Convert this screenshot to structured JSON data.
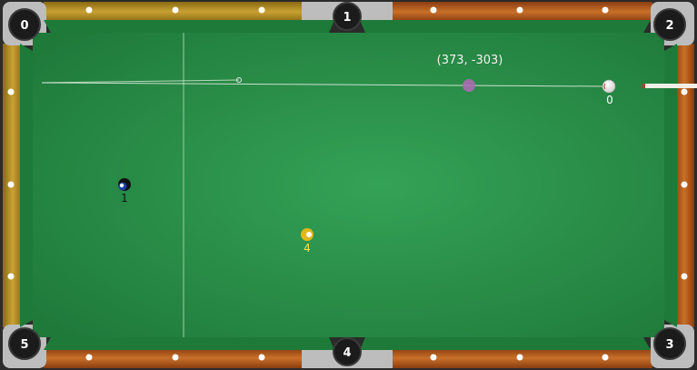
{
  "pockets": [
    {
      "id": "pocket-0",
      "label": "0"
    },
    {
      "id": "pocket-1",
      "label": "1"
    },
    {
      "id": "pocket-2",
      "label": "2"
    },
    {
      "id": "pocket-3",
      "label": "3"
    },
    {
      "id": "pocket-4",
      "label": "4"
    },
    {
      "id": "pocket-5",
      "label": "5"
    }
  ],
  "balls": [
    {
      "id": "cue",
      "label": "0",
      "color": "#ffffff",
      "label_color": "#ffffff"
    },
    {
      "id": "ball-1",
      "label": "1",
      "color": "#1a3fa0",
      "label_color": "#111111"
    },
    {
      "id": "ball-4",
      "label": "4",
      "color": "#e0b818",
      "label_color": "#ffe14a"
    }
  ],
  "aim": {
    "coordinate_text": "(373, -303)",
    "target_color": "#b06ab8"
  },
  "colors": {
    "felt": "#2f9a4f",
    "rail_wood": "#b8621f",
    "rail_gold": "#b8941f",
    "cushion": "#1f7a3a",
    "pocket": "#1b1b1b"
  }
}
